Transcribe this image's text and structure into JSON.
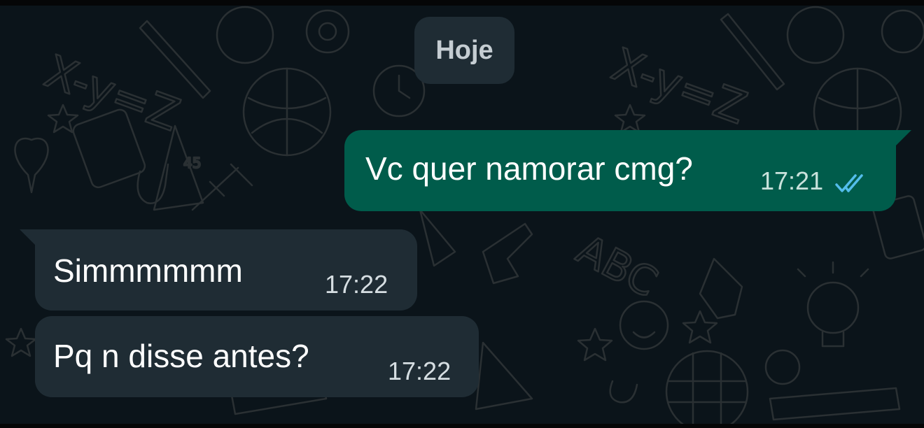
{
  "date_chip": "Hoje",
  "colors": {
    "background": "#0b141a",
    "outgoing_bubble": "#005c4b",
    "incoming_bubble": "#1f2c34",
    "read_ticks": "#53bdeb"
  },
  "messages": [
    {
      "direction": "outgoing",
      "text": "Vc quer namorar cmg?",
      "time": "17:21",
      "status_icon": "double-check-read-icon"
    },
    {
      "direction": "incoming",
      "text": "Simmmmmm",
      "time": "17:22"
    },
    {
      "direction": "incoming",
      "text": "Pq n disse antes?",
      "time": "17:22"
    }
  ]
}
